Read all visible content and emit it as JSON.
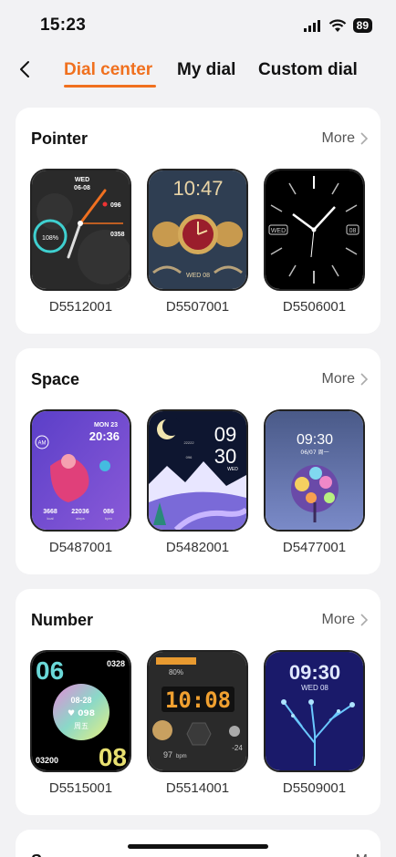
{
  "status": {
    "time": "15:23",
    "battery": "89"
  },
  "nav": {
    "tabs": [
      {
        "label": "Dial center",
        "active": true
      },
      {
        "label": "My dial",
        "active": false
      },
      {
        "label": "Custom dial",
        "active": false
      }
    ]
  },
  "sections": [
    {
      "title": "Pointer",
      "more": "More",
      "dials": [
        {
          "id": "D5512001"
        },
        {
          "id": "D5507001"
        },
        {
          "id": "D5506001"
        }
      ]
    },
    {
      "title": "Space",
      "more": "More",
      "dials": [
        {
          "id": "D5487001"
        },
        {
          "id": "D5482001"
        },
        {
          "id": "D5477001"
        }
      ]
    },
    {
      "title": "Number",
      "more": "More",
      "dials": [
        {
          "id": "D5515001"
        },
        {
          "id": "D5514001"
        },
        {
          "id": "D5509001"
        }
      ]
    },
    {
      "title": "Sp",
      "more": "M"
    }
  ],
  "faces": {
    "d5512001": {
      "day": "WED",
      "date": "06-08",
      "pct": "108%",
      "v1": "096",
      "v2": "0358"
    },
    "d5507001": {
      "time": "10:47",
      "date": "WED 08"
    },
    "d5506001": {
      "day": "WED",
      "date": "08"
    },
    "d5487001": {
      "am": "AM",
      "date": "MON 23",
      "time": "20:36",
      "s1": "3668",
      "s2": "22036",
      "s3": "086",
      "u1": "kcal",
      "u2": "steps",
      "u3": "bpm"
    },
    "d5482001": {
      "hour": "09",
      "min": "30",
      "day": "WED",
      "small": "22222",
      "small2": "096"
    },
    "d5477001": {
      "time": "09:30",
      "date": "06/07 周一"
    },
    "d5515001": {
      "top": "06",
      "right": "0328",
      "date": "08-28",
      "hr": "♥ 098",
      "day": "周五",
      "steps": "03200",
      "bottom": "08"
    },
    "d5514001": {
      "time": "10:08",
      "pct": "80%",
      "bpm_v": "97",
      "bpm_u": "bpm",
      "temp": "-24"
    },
    "d5509001": {
      "time": "09:30",
      "date": "WED 08"
    }
  },
  "colors": {
    "accent": "#f0701e",
    "background": "#f2f2f4",
    "card": "#ffffff"
  }
}
